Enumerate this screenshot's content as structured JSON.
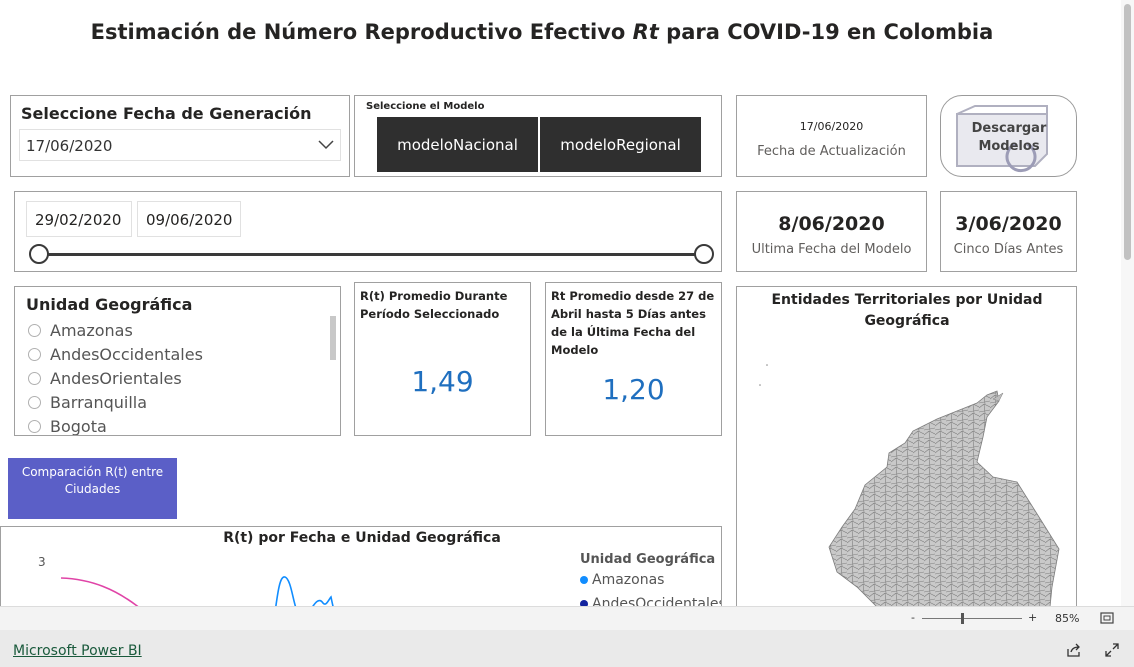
{
  "report": {
    "title_pre": "Estimación de Número Reproductivo Efectivo ",
    "title_rt": "Rt",
    "title_post": " para COVID-19 en Colombia"
  },
  "fecha_generacion": {
    "label": "Seleccione Fecha de Generación",
    "value": "17/06/2020"
  },
  "modelo": {
    "label": "Seleccione el Modelo",
    "options": [
      "modeloNacional",
      "modeloRegional"
    ]
  },
  "actualizacion": {
    "value": "17/06/2020",
    "label": "Fecha de Actualización"
  },
  "descargar": {
    "label": "Descargar Modelos"
  },
  "rango": {
    "start": "29/02/2020",
    "end": "09/06/2020"
  },
  "ultima_fecha": {
    "value": "8/06/2020",
    "label": "Ultima Fecha del Modelo"
  },
  "cinco_dias": {
    "value": "3/06/2020",
    "label": "Cinco Días Antes"
  },
  "unidad": {
    "label": "Unidad Geográfica",
    "items": [
      "Amazonas",
      "AndesOccidentales",
      "AndesOrientales",
      "Barranquilla",
      "Bogota"
    ]
  },
  "kpi1": {
    "label": "R(t) Promedio Durante Período Seleccionado",
    "value": "1,49"
  },
  "kpi2": {
    "label": "Rt Promedio desde 27 de Abril hasta 5 Días antes de la Última Fecha del Modelo",
    "value": "1,20"
  },
  "mapa": {
    "title": "Entidades Territoriales por Unidad Geográfica"
  },
  "comparacion": {
    "label": "Comparación R(t) entre Ciudades"
  },
  "chart_title": "R(t) por Fecha e Unidad Geográfica",
  "chart_data": {
    "type": "line",
    "title": "R(t) por Fecha e Unidad Geográfica",
    "ytick_top": "3",
    "legend_title": "Unidad Geográfica",
    "series": [
      {
        "name": "Amazonas",
        "color": "#118dff"
      },
      {
        "name": "AndesOccidentales",
        "color": "#12239e"
      }
    ]
  },
  "statusbar": {
    "zoom": "85%",
    "minus": "-",
    "plus": "+"
  },
  "footer": {
    "brand": "Microsoft Power BI"
  }
}
